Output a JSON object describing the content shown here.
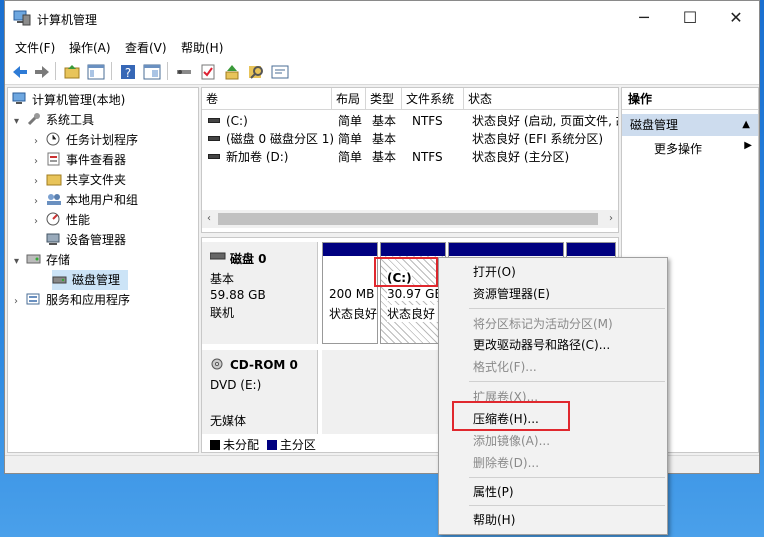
{
  "window": {
    "title": "计算机管理"
  },
  "window_controls": {
    "minimize": "─",
    "maximize": "☐",
    "close": "✕"
  },
  "menu": [
    "文件(F)",
    "操作(A)",
    "查看(V)",
    "帮助(H)"
  ],
  "tree": {
    "root": "计算机管理(本地)",
    "system_tools": "系统工具",
    "task_scheduler": "任务计划程序",
    "event_viewer": "事件查看器",
    "shared_folders": "共享文件夹",
    "local_users": "本地用户和组",
    "performance": "性能",
    "device_manager": "设备管理器",
    "storage": "存储",
    "disk_management": "磁盘管理",
    "services": "服务和应用程序"
  },
  "volume_table": {
    "headers": [
      "卷",
      "布局",
      "类型",
      "文件系统",
      "状态"
    ],
    "rows": [
      [
        "(C:)",
        "简单",
        "基本",
        "NTFS",
        "状态良好 (启动, 页面文件, 故"
      ],
      [
        "(磁盘 0 磁盘分区 1)",
        "简单",
        "基本",
        "",
        "状态良好 (EFI 系统分区)"
      ],
      [
        "新加卷 (D:)",
        "简单",
        "基本",
        "NTFS",
        "状态良好 (主分区)"
      ]
    ]
  },
  "disk0": {
    "name": "磁盘 0",
    "type": "基本",
    "size": "59.88 GB",
    "status": "联机",
    "part1": {
      "size": "200 MB",
      "status": "状态良好"
    },
    "part2": {
      "name": "(C:)",
      "size": "30.97 GB",
      "status": "状态良好 ("
    }
  },
  "cdrom": {
    "name": "CD-ROM 0",
    "type": "DVD (E:)",
    "media": "无媒体"
  },
  "legend": {
    "unallocated": "未分配",
    "primary": "主分区"
  },
  "actions": {
    "header": "操作",
    "section": "磁盘管理",
    "more": "更多操作"
  },
  "context_menu": {
    "open": "打开(O)",
    "explorer": "资源管理器(E)",
    "mark_active": "将分区标记为活动分区(M)",
    "change_letter": "更改驱动器号和路径(C)...",
    "format": "格式化(F)...",
    "extend": "扩展卷(X)...",
    "shrink": "压缩卷(H)...",
    "add_mirror": "添加镜像(A)...",
    "delete": "删除卷(D)...",
    "properties": "属性(P)",
    "help": "帮助(H)"
  },
  "colors": {
    "partition_bar": "#000080",
    "highlight": "#e0282e",
    "selection": "#cce4f7"
  }
}
